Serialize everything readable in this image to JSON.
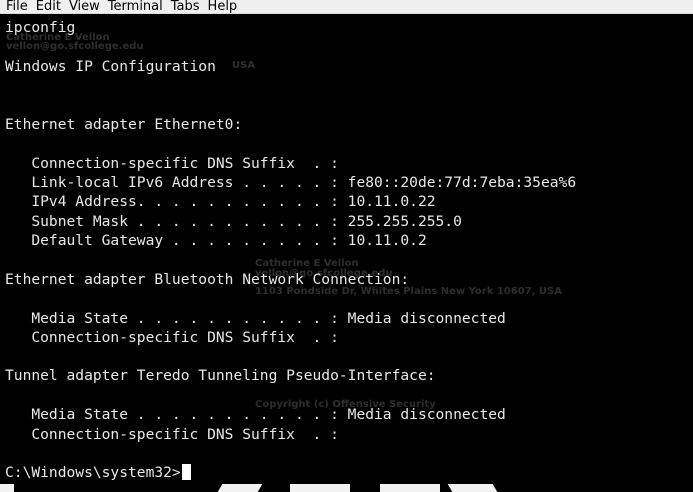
{
  "menubar": {
    "items": [
      "File",
      "Edit",
      "View",
      "Terminal",
      "Tabs",
      "Help"
    ]
  },
  "terminal": {
    "lines": [
      "ipconfig",
      "",
      "Windows IP Configuration",
      "",
      "",
      "Ethernet adapter Ethernet0:",
      "",
      "   Connection-specific DNS Suffix  . :",
      "   Link-local IPv6 Address . . . . . : fe80::20de:77d:7eba:35ea%6",
      "   IPv4 Address. . . . . . . . . . . : 10.11.0.22",
      "   Subnet Mask . . . . . . . . . . . : 255.255.255.0",
      "   Default Gateway . . . . . . . . . : 10.11.0.2",
      "",
      "Ethernet adapter Bluetooth Network Connection:",
      "",
      "   Media State . . . . . . . . . . . : Media disconnected",
      "   Connection-specific DNS Suffix  . :",
      "",
      "Tunnel adapter Teredo Tunneling Pseudo-Interface:",
      "",
      "   Media State . . . . . . . . . . . : Media disconnected",
      "   Connection-specific DNS Suffix  . :",
      "",
      "C:\\Windows\\system32>"
    ]
  },
  "watermarks": {
    "top_name": "Catherine E Vellon",
    "top_email": "vellon@go.sfcollege.edu",
    "top_country": "USA",
    "mid_name": "Catherine E Vellon",
    "mid_email": "vellon@go.sfcollege.edu",
    "mid_address": "1103 Pondside Dr, Whites Plains New York 10607, USA",
    "copyright": "Copyright (c) Offensive Security"
  },
  "colors": {
    "terminal_bg": "#000000",
    "terminal_fg": "#e8e8e8",
    "menubar_bg": "#f0f0f0"
  }
}
